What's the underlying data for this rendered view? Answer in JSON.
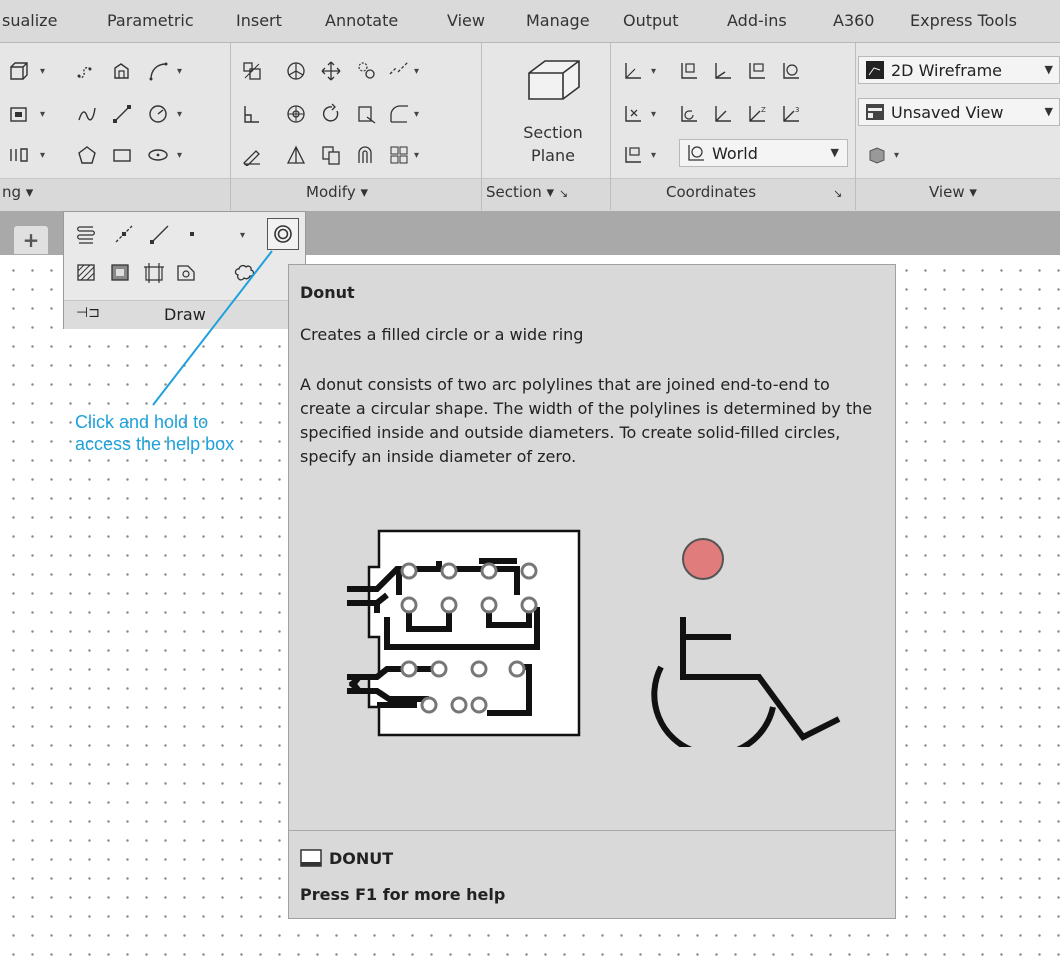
{
  "tabs": [
    "sualize",
    "Parametric",
    "Insert",
    "Annotate",
    "View",
    "Manage",
    "Output",
    "Add-ins",
    "A360",
    "Express Tools"
  ],
  "ribbon": {
    "section_plane_label": "Section Plane",
    "panels": {
      "draw_partial": "ng",
      "modify": "Modify",
      "section": "Section",
      "coordinates": "Coordinates",
      "view": "View"
    },
    "visual_style": "2D Wireframe",
    "named_view": "Unsaved View",
    "ucs": "World"
  },
  "filetab": {
    "plus": "+"
  },
  "flyout": {
    "title": "Draw"
  },
  "tooltip": {
    "title": "Donut",
    "subtitle": "Creates a filled circle or a wide ring",
    "description": "A donut consists of two arc polylines that are joined end-to-end to create a circular shape. The width of the polylines is determined by the specified inside and outside diameters. To create solid-filled circles, specify an inside diameter of zero.",
    "command": "DONUT",
    "help": "Press F1 for more help"
  },
  "callout": {
    "text": "Click and hold to access the help box",
    "color": "#1ea1dc"
  },
  "colors": {
    "callout_line": "#1ea1dc",
    "donut_red": "#e07c7c",
    "tooltip_bg": "#d9d9d9"
  }
}
